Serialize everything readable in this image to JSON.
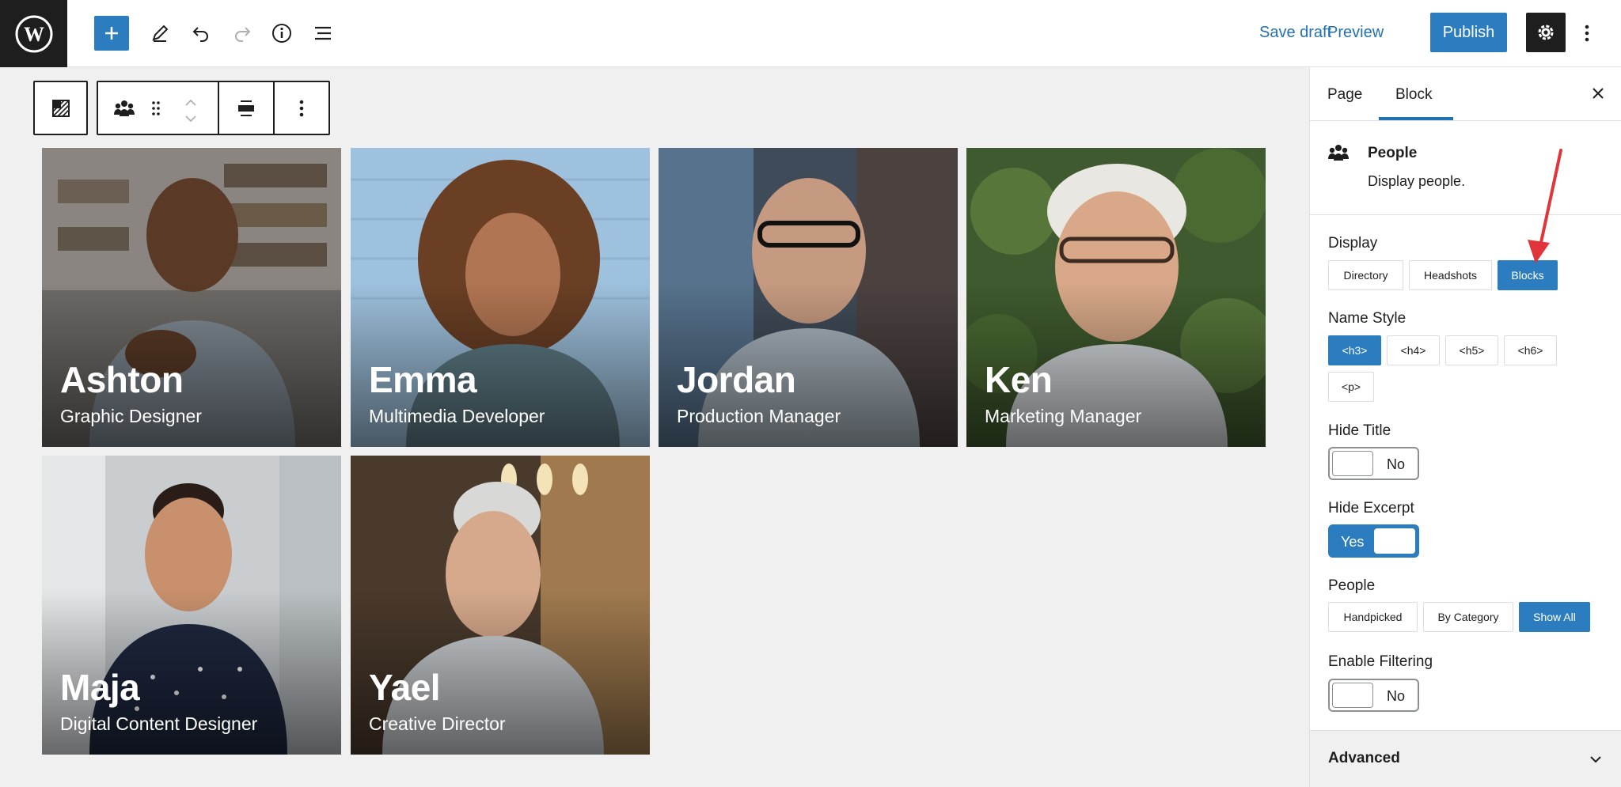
{
  "topbar": {
    "save_draft": "Save draft",
    "preview": "Preview",
    "publish": "Publish",
    "icons": [
      "wordpress-logo-icon",
      "plus-icon",
      "pencil-icon",
      "undo-icon",
      "redo-icon",
      "info-icon",
      "list-view-icon",
      "gear-icon",
      "more-vertical-icon"
    ]
  },
  "block_toolbar": {
    "icons": [
      "cover-block-icon",
      "people-block-icon",
      "drag-handle-icon",
      "move-up-icon",
      "move-down-icon",
      "align-icon",
      "more-vertical-icon"
    ]
  },
  "people": [
    {
      "name": "Ashton",
      "role": "Graphic Designer"
    },
    {
      "name": "Emma",
      "role": "Multimedia Developer"
    },
    {
      "name": "Jordan",
      "role": "Production Manager"
    },
    {
      "name": "Ken",
      "role": "Marketing Manager"
    },
    {
      "name": "Maja",
      "role": "Digital Content Designer"
    },
    {
      "name": "Yael",
      "role": "Creative Director"
    }
  ],
  "sidebar": {
    "tabs": [
      "Page",
      "Block"
    ],
    "active_tab": "Block",
    "block": {
      "title": "People",
      "description": "Display people."
    },
    "display": {
      "label": "Display",
      "options": [
        "Directory",
        "Headshots",
        "Blocks"
      ],
      "selected": "Blocks"
    },
    "name_style": {
      "label": "Name Style",
      "options": [
        "<h3>",
        "<h4>",
        "<h5>",
        "<h6>",
        "<p>"
      ],
      "selected": "<h3>"
    },
    "hide_title": {
      "label": "Hide Title",
      "state": "No"
    },
    "hide_excerpt": {
      "label": "Hide Excerpt",
      "state": "Yes"
    },
    "people_filter": {
      "label": "People",
      "options": [
        "Handpicked",
        "By Category",
        "Show All"
      ],
      "selected": "Show All"
    },
    "enable_filtering": {
      "label": "Enable Filtering",
      "state": "No"
    },
    "advanced": "Advanced"
  },
  "colors": {
    "accent": "#2c7dc0",
    "link": "#2271b1",
    "annotation_arrow": "#e0353a"
  }
}
